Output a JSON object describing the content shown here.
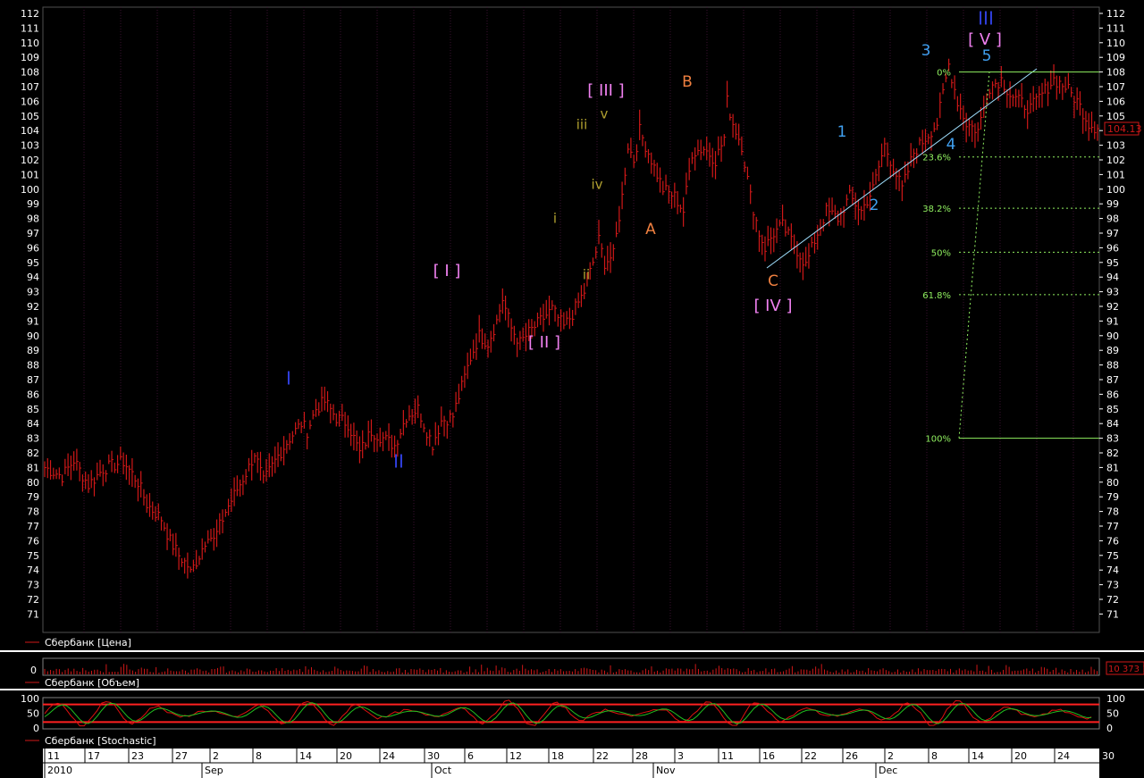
{
  "panels": {
    "price_caption": "Сбербанк [Цена]",
    "volume_caption": "Сбербанк [Объем]",
    "stoch_caption": "Сбербанк [Stochastic]"
  },
  "colors": {
    "background": "#000000",
    "grid": "#3a1030",
    "price": "#d01818",
    "wave_blue": "#3040e0",
    "wave_cyan": "#40a0f0",
    "wave_pink": "#f080f0",
    "wave_orange": "#f08040",
    "wave_olive": "#b0a030",
    "fib": "#90f060",
    "trendline": "#a0e0ff",
    "stoch_k": "#e01010",
    "stoch_d": "#20c020"
  },
  "chart_data": [
    {
      "type": "line",
      "title": "",
      "series_name": "Сбербанк [Цена]",
      "ylim": [
        70,
        112
      ],
      "y_ticks": [
        71,
        72,
        73,
        74,
        75,
        76,
        77,
        78,
        79,
        80,
        81,
        82,
        83,
        84,
        85,
        86,
        87,
        88,
        89,
        90,
        91,
        92,
        93,
        94,
        95,
        96,
        97,
        98,
        99,
        100,
        101,
        102,
        103,
        104,
        105,
        106,
        107,
        108,
        109,
        110,
        111,
        112
      ],
      "last_price_label": "104.13",
      "last_price": 104.13,
      "points": [
        [
          0,
          81.0
        ],
        [
          6,
          80.4
        ],
        [
          10,
          81.5
        ],
        [
          15,
          79.8
        ],
        [
          20,
          80.9
        ],
        [
          27,
          81.4
        ],
        [
          32,
          80.0
        ],
        [
          35,
          78.5
        ],
        [
          40,
          77.5
        ],
        [
          43,
          76.0
        ],
        [
          46,
          75.0
        ],
        [
          49,
          74.3
        ],
        [
          50,
          73.8
        ],
        [
          53,
          75.0
        ],
        [
          56,
          76.5
        ],
        [
          58,
          76.0
        ],
        [
          62,
          78.0
        ],
        [
          66,
          79.5
        ],
        [
          70,
          81.0
        ],
        [
          72,
          82.0
        ],
        [
          75,
          80.0
        ],
        [
          80,
          81.8
        ],
        [
          84,
          83.0
        ],
        [
          88,
          84.0
        ],
        [
          90,
          83.5
        ],
        [
          93,
          85.0
        ],
        [
          96,
          85.5
        ],
        [
          100,
          84.4
        ],
        [
          104,
          84.0
        ],
        [
          108,
          82.0
        ],
        [
          112,
          83.5
        ],
        [
          116,
          83.0
        ],
        [
          120,
          82.5
        ],
        [
          124,
          84.5
        ],
        [
          128,
          85.0
        ],
        [
          131,
          83.5
        ],
        [
          133,
          82.6
        ],
        [
          136,
          84.2
        ],
        [
          140,
          84.5
        ],
        [
          143,
          86.5
        ],
        [
          146,
          88.5
        ],
        [
          149,
          90.0
        ],
        [
          152,
          89.5
        ],
        [
          155,
          91.0
        ],
        [
          157,
          92.5
        ],
        [
          160,
          90.5
        ],
        [
          163,
          89.5
        ],
        [
          166,
          90.2
        ],
        [
          170,
          91.0
        ],
        [
          174,
          91.8
        ],
        [
          178,
          90.6
        ],
        [
          181,
          91.5
        ],
        [
          185,
          93.0
        ],
        [
          188,
          95.0
        ],
        [
          190,
          96.5
        ],
        [
          192,
          95.0
        ],
        [
          195,
          95.5
        ],
        [
          198,
          99.5
        ],
        [
          200,
          103.0
        ],
        [
          202,
          102.0
        ],
        [
          204,
          104.0
        ],
        [
          206,
          103.0
        ],
        [
          209,
          101.5
        ],
        [
          212,
          100.0
        ],
        [
          216,
          99.5
        ],
        [
          219,
          98.5
        ],
        [
          222,
          102.5
        ],
        [
          226,
          102.8
        ],
        [
          230,
          102.0
        ],
        [
          233,
          103.5
        ],
        [
          234,
          106.0
        ],
        [
          236,
          104.5
        ],
        [
          239,
          103.0
        ],
        [
          242,
          99.5
        ],
        [
          245,
          97.0
        ],
        [
          247,
          96.0
        ],
        [
          250,
          97.0
        ],
        [
          253,
          97.5
        ],
        [
          256,
          96.5
        ],
        [
          259,
          95.5
        ],
        [
          261,
          94.8
        ],
        [
          264,
          96.5
        ],
        [
          268,
          98.5
        ],
        [
          272,
          98.0
        ],
        [
          276,
          99.5
        ],
        [
          280,
          98.5
        ],
        [
          284,
          100.0
        ],
        [
          288,
          103.0
        ],
        [
          291,
          101.5
        ],
        [
          294,
          100.0
        ],
        [
          298,
          102.5
        ],
        [
          302,
          103.5
        ],
        [
          306,
          104.5
        ],
        [
          310,
          108.5
        ],
        [
          313,
          106.0
        ],
        [
          316,
          104.5
        ],
        [
          320,
          104.0
        ],
        [
          324,
          107.0
        ],
        [
          328,
          107.5
        ],
        [
          331,
          106.5
        ],
        [
          334,
          106.0
        ],
        [
          338,
          105.5
        ],
        [
          342,
          106.5
        ],
        [
          346,
          107.5
        ],
        [
          350,
          107.0
        ],
        [
          354,
          106.0
        ],
        [
          358,
          104.5
        ],
        [
          361,
          104.13
        ]
      ]
    },
    {
      "type": "bar",
      "series_name": "Сбербанк [Объем]",
      "y_ticks": [
        0
      ],
      "last_value_label": "10 373 1"
    },
    {
      "type": "line",
      "series_name": "Сбербанк [Stochastic]",
      "ylim": [
        0,
        100
      ],
      "y_ticks": [
        0,
        50,
        100
      ],
      "levels": [
        80,
        20
      ]
    }
  ],
  "time_axis": {
    "days": [
      "11",
      "17",
      "23",
      "27",
      "2",
      "8",
      "14",
      "20",
      "24",
      "30",
      "6",
      "12",
      "18",
      "22",
      "28",
      "3",
      "11",
      "16",
      "22",
      "26",
      "2",
      "8",
      "14",
      "20",
      "24",
      "30"
    ],
    "months": [
      "2010",
      "Sep",
      "Oct",
      "Nov",
      "Dec"
    ]
  },
  "waves": [
    {
      "text": "I",
      "color": "wave_blue",
      "x": 323,
      "y": 425,
      "size": 20
    },
    {
      "text": "II",
      "color": "wave_blue",
      "x": 446,
      "y": 518,
      "size": 20
    },
    {
      "text": "[ I ]",
      "color": "wave_pink",
      "x": 500,
      "y": 304,
      "size": 18
    },
    {
      "text": "[ II ]",
      "color": "wave_pink",
      "x": 609,
      "y": 384,
      "size": 18
    },
    {
      "text": "[ III ]",
      "color": "wave_pink",
      "x": 678,
      "y": 102,
      "size": 18
    },
    {
      "text": "[ IV ]",
      "color": "wave_pink",
      "x": 865,
      "y": 343,
      "size": 18
    },
    {
      "text": "[ V ]",
      "color": "wave_pink",
      "x": 1102,
      "y": 45,
      "size": 18
    },
    {
      "text": "III",
      "color": "wave_blue",
      "x": 1103,
      "y": 22,
      "size": 20
    },
    {
      "text": "i",
      "color": "wave_olive",
      "x": 621,
      "y": 245,
      "size": 15
    },
    {
      "text": "ii",
      "color": "wave_olive",
      "x": 656,
      "y": 308,
      "size": 15
    },
    {
      "text": "iii",
      "color": "wave_olive",
      "x": 651,
      "y": 140,
      "size": 15
    },
    {
      "text": "iv",
      "color": "wave_olive",
      "x": 668,
      "y": 207,
      "size": 15
    },
    {
      "text": "v",
      "color": "wave_olive",
      "x": 676,
      "y": 128,
      "size": 15
    },
    {
      "text": "A",
      "color": "wave_orange",
      "x": 728,
      "y": 257,
      "size": 17
    },
    {
      "text": "B",
      "color": "wave_orange",
      "x": 769,
      "y": 92,
      "size": 17
    },
    {
      "text": "C",
      "color": "wave_orange",
      "x": 865,
      "y": 315,
      "size": 17
    },
    {
      "text": "1",
      "color": "wave_cyan",
      "x": 942,
      "y": 148,
      "size": 17
    },
    {
      "text": "2",
      "color": "wave_cyan",
      "x": 978,
      "y": 230,
      "size": 17
    },
    {
      "text": "3",
      "color": "wave_cyan",
      "x": 1036,
      "y": 57,
      "size": 17
    },
    {
      "text": "4",
      "color": "wave_cyan",
      "x": 1064,
      "y": 162,
      "size": 17
    },
    {
      "text": "5",
      "color": "wave_cyan",
      "x": 1104,
      "y": 63,
      "size": 17
    }
  ],
  "fibonacci": [
    {
      "label": "0%",
      "price": 108.0
    },
    {
      "label": "23.6%",
      "price": 102.2
    },
    {
      "label": "38.2%",
      "price": 98.7
    },
    {
      "label": "50%",
      "price": 95.7
    },
    {
      "label": "61.8%",
      "price": 92.8
    },
    {
      "label": "100%",
      "price": 83.0
    }
  ]
}
